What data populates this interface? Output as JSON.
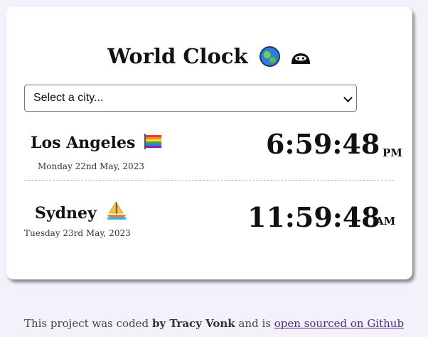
{
  "title": "World Clock",
  "title_icons": [
    "globe-icon",
    "ninja-icon"
  ],
  "select": {
    "value": "Select a city..."
  },
  "clocks": [
    {
      "city": "Los Angeles",
      "icon": "rainbow-flag-icon",
      "date": "Monday 22nd May, 2023",
      "time": "6:59:48",
      "ampm": "PM"
    },
    {
      "city": "Sydney",
      "icon": "sailboat-icon",
      "date": "Tuesday 23rd May, 2023",
      "time": "11:59:48",
      "ampm": "AM"
    }
  ],
  "footer": {
    "prefix": "This project was coded ",
    "author": "by Tracy Vonk",
    "middle": " and is ",
    "link": "open sourced on Github"
  }
}
